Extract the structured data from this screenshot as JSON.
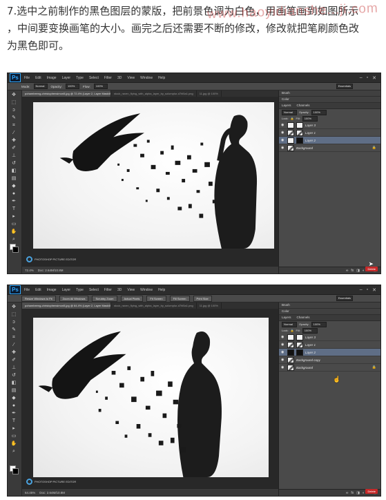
{
  "article": {
    "instruction_lines": [
      "7.选中之前制作的黑色图层的蒙版，把前景色调为白色，用画笔画到如图所示",
      "，中间要变换画笔的大小。画完之后还需要不断的修改，修改就把笔刷颜色改",
      "为黑色即可。"
    ],
    "watermark": "www.haoyidianshe...ji.com"
  },
  "app": {
    "logo": "Ps",
    "menu": [
      "File",
      "Edit",
      "Image",
      "Layer",
      "Type",
      "Select",
      "Filter",
      "3D",
      "View",
      "Window",
      "Help"
    ],
    "window_controls": [
      "–",
      "▫",
      "✕"
    ]
  },
  "screenshot_1": {
    "options": {
      "mode_label": "Mode:",
      "mode_value": "Normal",
      "opacity_label": "Opacity:",
      "opacity_value": "100%",
      "flow_label": "Flow:",
      "flow_value": "100%",
      "workspace": "Essentials"
    },
    "tabs": [
      "pohambeeng-christophensimon5.jpg @ 72.4% (Layer 2, Layer Mask/8) *",
      "stock_raven_flying_with_alpha_layer_by_solomplur-d7hl5a1.png",
      "11.jpg @ 100%"
    ],
    "status": {
      "zoom": "72.4%",
      "doc": "Doc: 2.64M/10.8M"
    },
    "panel_tabs": [
      "Brush",
      "Color"
    ],
    "layers_tabs": [
      "Layers",
      "Channels"
    ],
    "blend_mode": "Normal",
    "opacity_label": "Opacity:",
    "opacity_value": "100%",
    "lock_label": "Lock:",
    "fill_label": "Fill:",
    "fill_value": "100%",
    "layers": [
      {
        "name": "Layer 3",
        "thumb": "white",
        "selected": false
      },
      {
        "name": "Layer 1",
        "thumb": "photo",
        "selected": false
      },
      {
        "name": "Layer 2",
        "thumb": "black",
        "selected": true
      },
      {
        "name": "Background",
        "thumb": "photo",
        "selected": false
      }
    ],
    "corner_logo_text": "PHOTOSHOP PICTURE EDITOR",
    "delete_badge": "Delete"
  },
  "screenshot_2": {
    "options": {
      "btn_resize": "Resize Windows to Fit",
      "btn_zoom_all": "Zoom All Windows",
      "btn_scrubby": "Scrubby Zoom",
      "btn_actual": "Actual Pixels",
      "btn_fit": "Fit Screen",
      "btn_fill": "Fill Screen",
      "btn_print": "Print Size",
      "workspace": "Essentials"
    },
    "tabs": [
      "pohambeeng-christophensimon5.jpg @ 64.4% (Layer 2, Layer Mask/8) *",
      "stock_raven_flying_with_alpha_layer_by_solomplur-d7hl5a1.png",
      "11.jpg @ 100%"
    ],
    "status": {
      "zoom": "64.45%",
      "doc": "Doc: 2.64M/10.8M"
    },
    "panel_tabs": [
      "Brush",
      "Color"
    ],
    "layers_tabs": [
      "Layers",
      "Channels"
    ],
    "blend_mode": "Normal",
    "opacity_label": "Opacity:",
    "opacity_value": "100%",
    "lock_label": "Lock:",
    "fill_label": "Fill:",
    "fill_value": "100%",
    "layers": [
      {
        "name": "Layer 3",
        "thumb": "white",
        "selected": false
      },
      {
        "name": "Layer 1",
        "thumb": "photo",
        "selected": false
      },
      {
        "name": "Layer 2",
        "thumb": "black",
        "selected": true
      },
      {
        "name": "Background copy",
        "thumb": "photo",
        "selected": false
      },
      {
        "name": "Background",
        "thumb": "photo",
        "selected": false
      }
    ],
    "corner_logo_text": "PHOTOSHOP PICTURE EDITOR",
    "delete_badge": "Delete"
  },
  "colors": {
    "ps_dark": "#3c3c3c",
    "selected_layer": "#5f6e86",
    "accent": "#31a8ff",
    "delete_red": "#c62828"
  }
}
